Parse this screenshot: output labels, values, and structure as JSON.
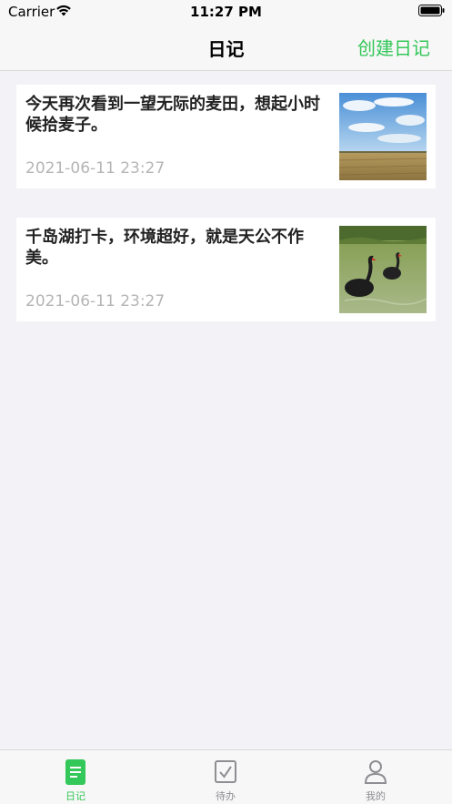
{
  "status_bar": {
    "carrier": "Carrier",
    "time": "11:27 PM"
  },
  "nav": {
    "title": "日记",
    "action_label": "创建日记"
  },
  "entries": [
    {
      "text": "今天再次看到一望无际的麦田，想起小时候拾麦子。",
      "date": "2021-06-11 23:27",
      "thumbnail": "wheat-field-photo"
    },
    {
      "text": "千岛湖打卡，环境超好，就是天公不作美。",
      "date": "2021-06-11 23:27",
      "thumbnail": "black-swans-photo"
    }
  ],
  "tabs": [
    {
      "label": "日记",
      "icon": "diary-icon",
      "active": true
    },
    {
      "label": "待办",
      "icon": "todo-check-icon",
      "active": false
    },
    {
      "label": "我的",
      "icon": "person-icon",
      "active": false
    }
  ],
  "colors": {
    "accent": "#34c759",
    "background": "#f2f2f7",
    "date_text": "#b5b5b5",
    "inactive_tab": "#8e8e93"
  }
}
